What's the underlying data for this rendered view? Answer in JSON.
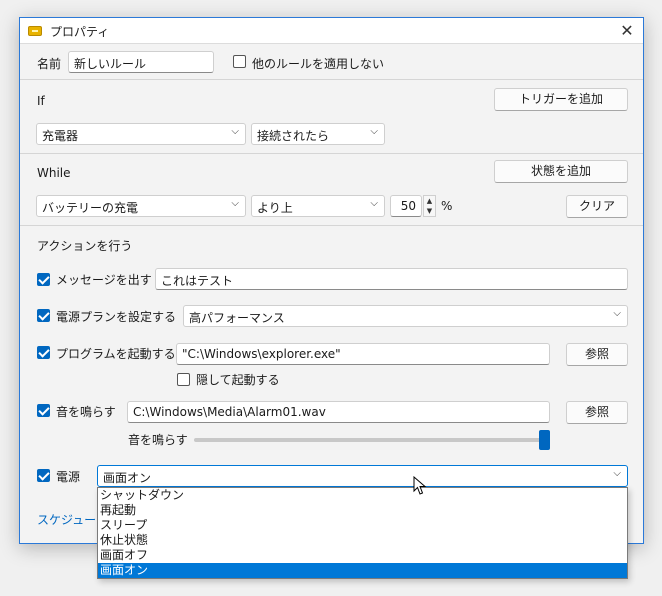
{
  "window": {
    "title": "プロパティ"
  },
  "name_row": {
    "label": "名前",
    "value": "新しいルール",
    "no_other_rules": "他のルールを適用しない"
  },
  "if_section": {
    "label": "If",
    "add_trigger": "トリガーを追加",
    "trigger_source": "充電器",
    "trigger_state": "接続されたら"
  },
  "while_section": {
    "label": "While",
    "add_state": "状態を追加",
    "condition": "バッテリーの充電",
    "comparator": "より上",
    "value": "50",
    "unit": "%",
    "clear": "クリア"
  },
  "actions": {
    "header": "アクションを行う",
    "message": {
      "label": "メッセージを出す",
      "value": "これはテスト"
    },
    "power_plan": {
      "label": "電源プランを設定する",
      "value": "高パフォーマンス"
    },
    "program": {
      "label": "プログラムを起動する",
      "value": "\"C:\\Windows\\explorer.exe\"",
      "browse": "参照",
      "hidden_label": "隠して起動する"
    },
    "sound": {
      "label": "音を鳴らす",
      "value": "C:\\Windows\\Media\\Alarm01.wav",
      "browse": "参照",
      "volume_label": "音を鳴らす",
      "volume_level": 1.0
    },
    "power": {
      "label": "電源",
      "value": "画面オン",
      "options": [
        "シャットダウン",
        "再起動",
        "スリープ",
        "休止状態",
        "画面オフ",
        "画面オン"
      ],
      "selected_index": 5
    }
  },
  "footer": {
    "schedule_link": "スケジューラ"
  },
  "colors": {
    "accent": "#0067c0",
    "selection": "#0078d7",
    "border": "#2b79d8"
  }
}
